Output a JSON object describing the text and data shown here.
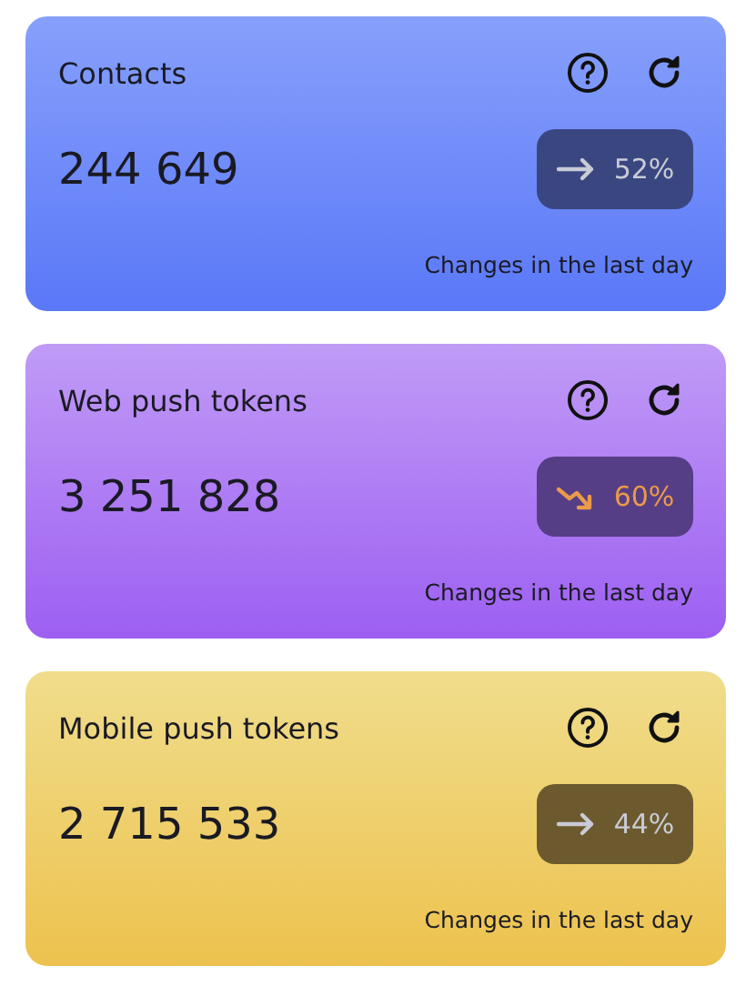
{
  "cards": [
    {
      "title": "Contacts",
      "value": "244 649",
      "trend": {
        "kind": "flat",
        "percent": "52%"
      },
      "caption": "Changes in the last day"
    },
    {
      "title": "Web push tokens",
      "value": "3 251 828",
      "trend": {
        "kind": "down",
        "percent": "60%"
      },
      "caption": "Changes in the last day"
    },
    {
      "title": "Mobile push tokens",
      "value": "2 715 533",
      "trend": {
        "kind": "flat",
        "percent": "44%"
      },
      "caption": "Changes in the last day"
    }
  ]
}
